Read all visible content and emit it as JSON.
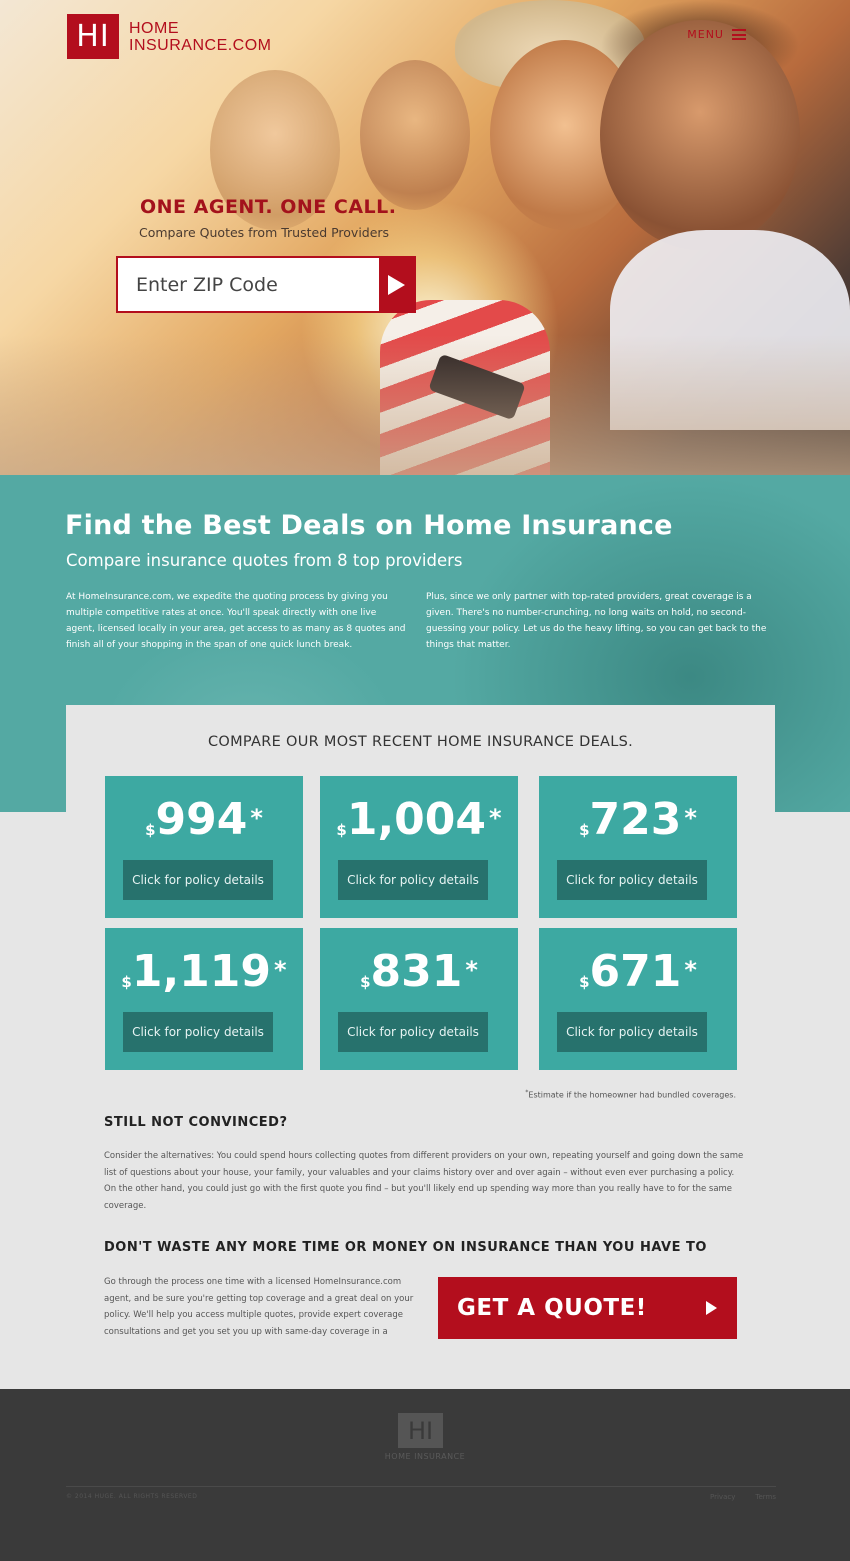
{
  "header": {
    "logo_mark": "HI",
    "logo_line1": "HOME",
    "logo_line2": "INSURANCE.COM",
    "menu_label": "MENU"
  },
  "hero": {
    "tagline": "ONE AGENT. ONE CALL.",
    "subtagline": "Compare Quotes from Trusted Providers",
    "zip_placeholder": "Enter ZIP Code"
  },
  "intro": {
    "title": "Find the Best Deals on Home Insurance",
    "subtitle": "Compare insurance quotes from 8 top providers",
    "col1": "At HomeInsurance.com, we expedite the quoting process by giving you multiple competitive rates at once. You'll speak directly with one live agent, licensed locally in your area, get access to as many as 8 quotes and finish all of your shopping in the span of one quick lunch break.",
    "col2": "Plus, since we only partner with top-rated providers, great coverage is a given. There's no number-crunching, no long waits on hold, no second-guessing your policy. Let us do the heavy lifting, so you can get back to the things that matter."
  },
  "deals": {
    "heading": "COMPARE OUR MOST RECENT HOME INSURANCE DEALS.",
    "currency": "$",
    "asterisk": "*",
    "items": [
      {
        "price": "994",
        "button": "Click for policy details"
      },
      {
        "price": "1,004",
        "button": "Click for policy details"
      },
      {
        "price": "723",
        "button": "Click for policy details"
      },
      {
        "price": "1,119",
        "button": "Click for policy details"
      },
      {
        "price": "831",
        "button": "Click for policy details"
      },
      {
        "price": "671",
        "button": "Click for policy details"
      }
    ],
    "footnote": "Estimate if the homeowner had bundled coverages."
  },
  "convince": {
    "heading": "STILL NOT CONVINCED?",
    "body": "Consider the alternatives: You could spend hours collecting quotes from different providers on your own, repeating yourself and going down the same list of questions about your house, your family, your valuables and your claims history over and over again – without even ever purchasing a policy. On the other hand, you could just go with the first quote you find – but you'll likely end up spending way more than you really have to for the same coverage."
  },
  "cta": {
    "heading": "DON'T WASTE ANY MORE TIME OR MONEY ON INSURANCE THAN YOU HAVE TO",
    "body": "Go through the process one time with a licensed HomeInsurance.com agent, and be sure you're getting top coverage and a great deal on your policy. We'll help you access multiple quotes, provide expert coverage consultations and get you set you up with same-day coverage in a matter",
    "button": "GET A QUOTE!"
  },
  "footer": {
    "logo_mark": "HI",
    "logo_text": "HOME INSURANCE",
    "copyright": "© 2014 HUGE. ALL RIGHTS RESERVED",
    "links": [
      "Privacy",
      "Terms"
    ]
  },
  "colors": {
    "brand_red": "#b30e1d",
    "teal": "#3da9a2",
    "teal_dark": "#27726d",
    "footer_bg": "#3a3a3a"
  }
}
